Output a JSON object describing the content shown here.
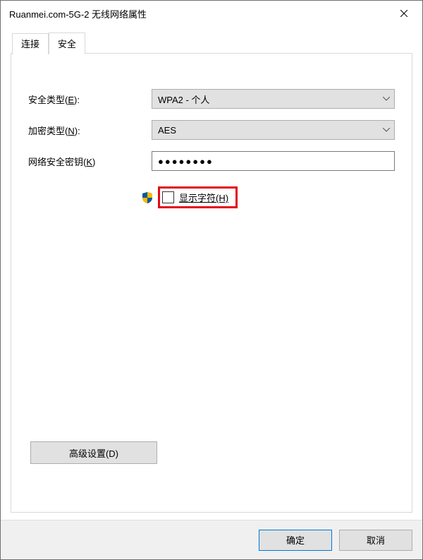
{
  "window": {
    "title": "Ruanmei.com-5G-2 无线网络属性"
  },
  "tabs": {
    "connect": "连接",
    "security": "安全"
  },
  "fields": {
    "securityTypeLabel": "安全类型(E):",
    "securityTypeValue": "WPA2 - 个人",
    "encryptionTypeLabel": "加密类型(N):",
    "encryptionTypeValue": "AES",
    "networkKeyLabel": "网络安全密钥(K)",
    "networkKeyValue": "●●●●●●●●",
    "showCharsLabel": "显示字符(H)"
  },
  "buttons": {
    "advanced": "高级设置(D)",
    "ok": "确定",
    "cancel": "取消"
  }
}
